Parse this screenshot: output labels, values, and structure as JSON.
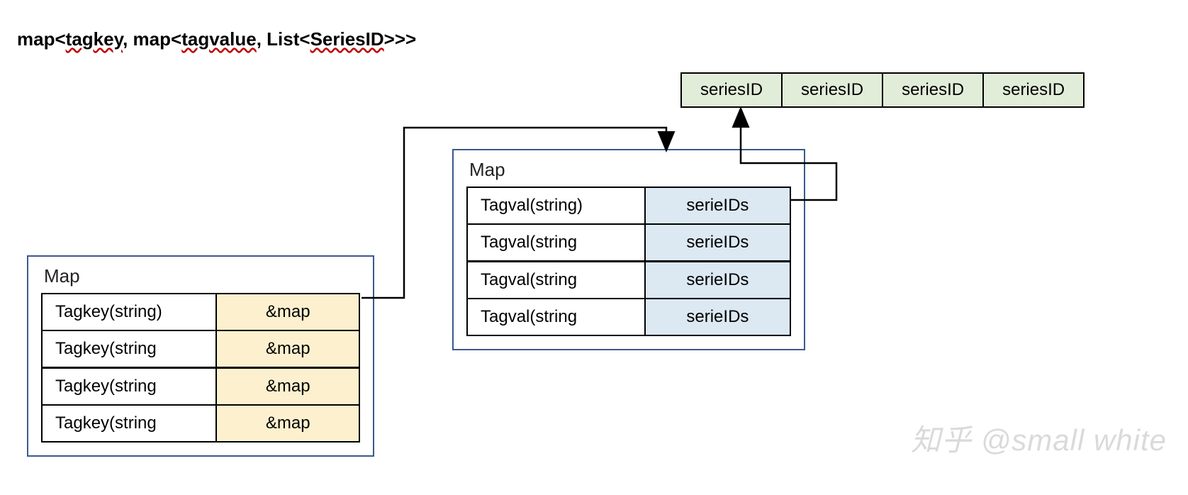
{
  "title_parts": {
    "p1": "map<",
    "u1": "tagkey",
    "p2": ", map<",
    "u2": "tagvalue",
    "p3": ", List<",
    "u3": "SeriesID",
    "p4": ">>>"
  },
  "left_map": {
    "label": "Map",
    "rows": [
      {
        "key": "Tagkey(string)",
        "val": "&map"
      },
      {
        "key": "Tagkey(string",
        "val": "&map"
      },
      {
        "key": "Tagkey(string",
        "val": "&map"
      },
      {
        "key": "Tagkey(string",
        "val": "&map"
      }
    ]
  },
  "right_map": {
    "label": "Map",
    "rows": [
      {
        "key": "Tagval(string)",
        "val": "serieIDs"
      },
      {
        "key": "Tagval(string",
        "val": "serieIDs"
      },
      {
        "key": "Tagval(string",
        "val": "serieIDs"
      },
      {
        "key": "Tagval(string",
        "val": "serieIDs"
      }
    ]
  },
  "series": [
    "seriesID",
    "seriesID",
    "seriesID",
    "seriesID"
  ],
  "watermark": "知乎 @small white"
}
